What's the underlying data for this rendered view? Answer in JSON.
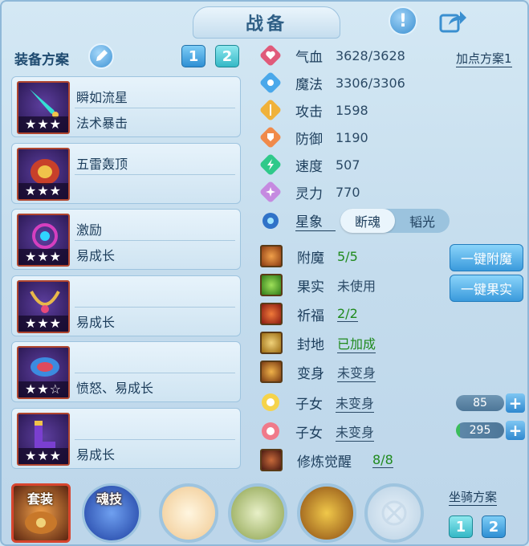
{
  "header": {
    "title": "战备"
  },
  "colors": {
    "accent": "#3a9adc",
    "green_value": "#1f8a1d",
    "text": "#1d3e5c"
  },
  "equipment_plan": {
    "label": "装备方案",
    "buttons": [
      "1",
      "2"
    ],
    "items": [
      {
        "name": "瞬如流星",
        "effect": "法术暴击",
        "stars": "★★★",
        "icon": "sword-icon"
      },
      {
        "name": "五雷轰顶",
        "effect": "",
        "stars": "★★★",
        "icon": "helmet-icon"
      },
      {
        "name": "激励",
        "effect": "易成长",
        "stars": "★★★",
        "icon": "necklace-icon"
      },
      {
        "name": "",
        "effect": "易成长",
        "stars": "★★★",
        "icon": "belt-icon"
      },
      {
        "name": "",
        "effect": "愤怒、易成长",
        "stars": "★★☆",
        "icon": "armor-icon"
      },
      {
        "name": "",
        "effect": "易成长",
        "stars": "★★★",
        "icon": "boots-icon"
      }
    ]
  },
  "stats": {
    "plan_link": "加点方案1",
    "rows": [
      {
        "label": "气血",
        "value": "3628/3628",
        "icon": "heart-icon"
      },
      {
        "label": "魔法",
        "value": "3306/3306",
        "icon": "mana-icon"
      },
      {
        "label": "攻击",
        "value": "1598",
        "icon": "attack-icon"
      },
      {
        "label": "防御",
        "value": "1190",
        "icon": "defense-icon"
      },
      {
        "label": "速度",
        "value": "507",
        "icon": "speed-icon"
      },
      {
        "label": "灵力",
        "value": "770",
        "icon": "spirit-icon"
      }
    ],
    "star_sign": {
      "label": "星象",
      "options": [
        "断魂",
        "韬光"
      ],
      "selected": "断魂"
    }
  },
  "buffs": [
    {
      "label": "附魔",
      "value": "5/5",
      "green": true,
      "underline": false
    },
    {
      "label": "果实",
      "value": "未使用",
      "green": false,
      "underline": false
    },
    {
      "label": "祈福",
      "value": "2/2",
      "green": true,
      "underline": false
    },
    {
      "label": "封地",
      "value": "已加成",
      "green": true,
      "underline": true
    },
    {
      "label": "变身",
      "value": "未变身",
      "green": false,
      "underline": true
    },
    {
      "label": "子女",
      "value": "未变身",
      "green": false,
      "underline": true
    },
    {
      "label": "子女",
      "value": "未变身",
      "green": false,
      "underline": true
    },
    {
      "label": "修炼觉醒",
      "value": "8/8",
      "green": true,
      "underline": true
    }
  ],
  "actions": {
    "enchant": "一键附魔",
    "fruit": "一键果实"
  },
  "children_sliders": [
    {
      "value": "85",
      "plus": "+"
    },
    {
      "value": "295",
      "plus": "+"
    }
  ],
  "bottom": {
    "suit_label": "套装",
    "soul_label": "魂技",
    "mount_label": "坐骑方案",
    "mount_buttons": [
      "1",
      "2"
    ]
  }
}
